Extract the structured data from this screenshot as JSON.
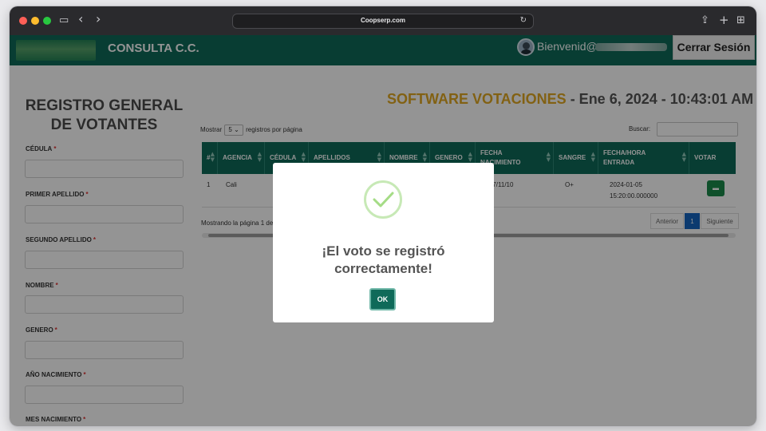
{
  "browser": {
    "url": "Coopserp.com",
    "reload_icon": "↻",
    "back_icon": "‹",
    "forward_icon": "›",
    "sidebar_icon": "▭",
    "share_icon": "⇪",
    "new_tab_icon": "+",
    "tabs_icon": "⊞"
  },
  "header": {
    "title": "CONSULTA C.C.",
    "welcome": "Bienvenid@",
    "logout_label": "Cerrar Sesión"
  },
  "form": {
    "title_line1": "REGISTRO GENERAL",
    "title_line2": "DE VOTANTES",
    "required_mark": "*",
    "fields": [
      {
        "label": "CÉDULA"
      },
      {
        "label": "PRIMER APELLIDO"
      },
      {
        "label": "SEGUNDO APELLIDO"
      },
      {
        "label": "NOMBRE"
      },
      {
        "label": "GENERO"
      },
      {
        "label": "AÑO NACIMIENTO"
      },
      {
        "label": "MES NACIMIENTO"
      }
    ]
  },
  "main": {
    "brand": "SOFTWARE VOTACIONES",
    "datetime": " - Ene 6, 2024 - 10:43:01 AM",
    "show_prefix": "Mostrar",
    "page_size": "5",
    "show_suffix": "registros por página",
    "search_label": "Buscar:",
    "columns": [
      "#",
      "AGENCIA",
      "CÉDULA",
      "APELLIDOS",
      "NOMBRE",
      "GENERO",
      "FECHA NACIMIENTO",
      "SANGRE",
      "FECHA/HORA ENTRADA",
      "VOTAR"
    ],
    "rows": [
      {
        "num": "1",
        "agencia": "Cali",
        "fecha_nac": "1997/11/10",
        "sangre": "O+",
        "entrada_fecha": "2024-01-05",
        "entrada_hora": "15:20:00.000000"
      }
    ],
    "footer_info": "Mostrando la página 1 de 1",
    "pager": {
      "prev": "Anterior",
      "current": "1",
      "next": "Siguiente"
    }
  },
  "modal": {
    "message": "¡El voto se registró correctamente!",
    "ok_label": "OK"
  },
  "colors": {
    "primary": "#0f6a59",
    "brand_yellow": "#e0a822",
    "success_green": "#a5dc86"
  }
}
